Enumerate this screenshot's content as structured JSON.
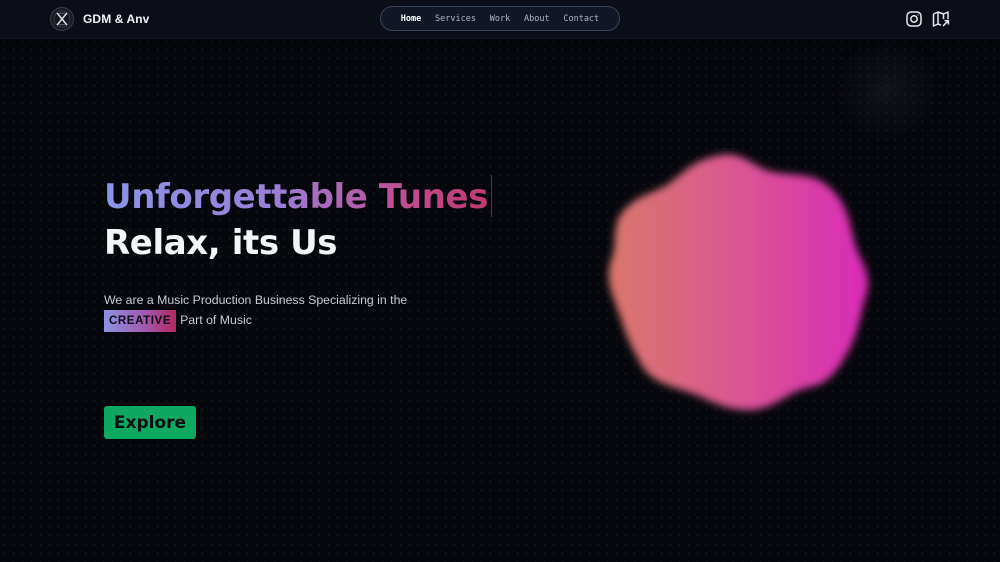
{
  "brand": {
    "name": "GDM & Anv",
    "logo_icon": "x-logo-icon"
  },
  "nav": {
    "items": [
      {
        "label": "Home",
        "active": true
      },
      {
        "label": "Services",
        "active": false
      },
      {
        "label": "Work",
        "active": false
      },
      {
        "label": "About",
        "active": false
      },
      {
        "label": "Contact",
        "active": false
      }
    ]
  },
  "social": {
    "icons": [
      "instagram-icon",
      "map-icon"
    ]
  },
  "hero": {
    "title_line1": "Unforgettable Tunes",
    "title_line2": "Relax, its Us",
    "tagline_before": "We are a Music Production Business Specializing in the",
    "tagline_highlight": "CREATIVE",
    "tagline_after": "Part of Music",
    "cta_label": "Explore"
  },
  "colors": {
    "background": "#06070c",
    "topbar": "#0b0e16",
    "accent_green": "#0ea860",
    "blob_start": "#d9786a",
    "blob_end": "#d92ab6",
    "title_gradient_start": "#8a95e6",
    "title_gradient_end": "#c0396f"
  }
}
